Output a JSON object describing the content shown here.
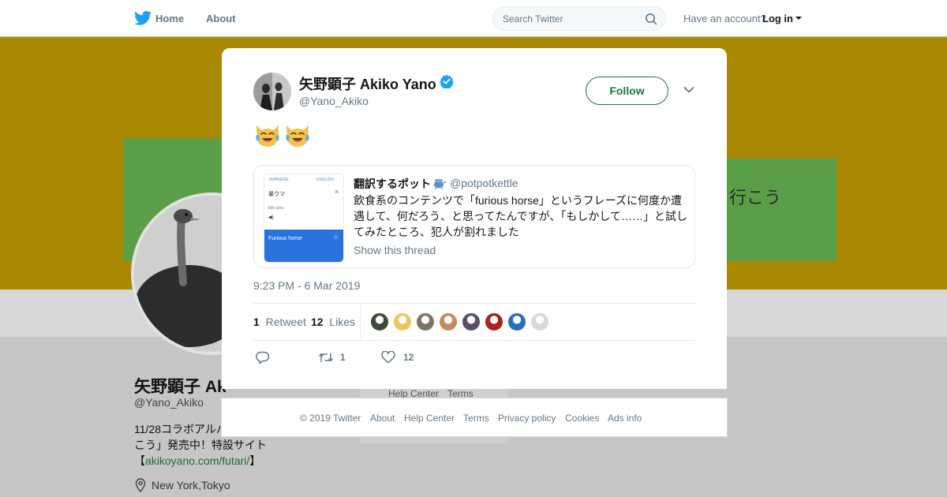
{
  "topnav": {
    "home_label": "Home",
    "about_label": "About",
    "search_placeholder": "Search Twitter",
    "account_prompt": "Have an account?",
    "login_label": "Log in"
  },
  "background_profile": {
    "banner_text": "行こう",
    "name": "矢野顕子 Ak",
    "handle": "@Yano_Akiko",
    "bio_line1": "11/28コラボアルバ",
    "bio_line2": "こう」発売中！特設サイト",
    "bio_link_open": "【",
    "bio_link": "akikoyano.com/futari/",
    "bio_link_close": "】",
    "location": "New York,Tokyo",
    "footer_help": "Help Center",
    "footer_terms": "Terms"
  },
  "tweet": {
    "author_name": "矢野顕子 Akiko Yano",
    "author_handle": "@Yano_Akiko",
    "follow_label": "Follow",
    "emoji_count": 2,
    "emoji_icon": "cat-tears-of-joy-icon",
    "quoted": {
      "thumb_lang_from": "JAPANESE",
      "thumb_lang_to": "ENGLISH",
      "thumb_source": "暴ウマ",
      "thumb_romaji": "bōk uma",
      "thumb_translation": "Furious horse",
      "author_name": "翻訳するポット",
      "author_handle": "@potpotkettle",
      "text": "飲食系のコンテンツで「furious horse」というフレーズに何度か遭遇して、何だろう、と思ってたんですが、「もしかして……」と試してみたところ、犯人が割れました",
      "show_thread": "Show this thread"
    },
    "timestamp": "9:23 PM - 6 Mar 2019",
    "retweet_count": "1",
    "retweet_label": "Retweet",
    "like_count": "12",
    "like_label": "Likes",
    "liker_colors": [
      "#3f4a3a",
      "#e8c95a",
      "#7d7466",
      "#c98a5b",
      "#5a4d6b",
      "#a8241d",
      "#2a6fb5",
      "#d9d9d9"
    ],
    "action_retweets": "1",
    "action_likes": "12"
  },
  "footer": {
    "copyright": "© 2019 Twitter",
    "about": "About",
    "help": "Help Center",
    "terms": "Terms",
    "privacy": "Privacy policy",
    "cookies": "Cookies",
    "ads": "Ads info"
  }
}
